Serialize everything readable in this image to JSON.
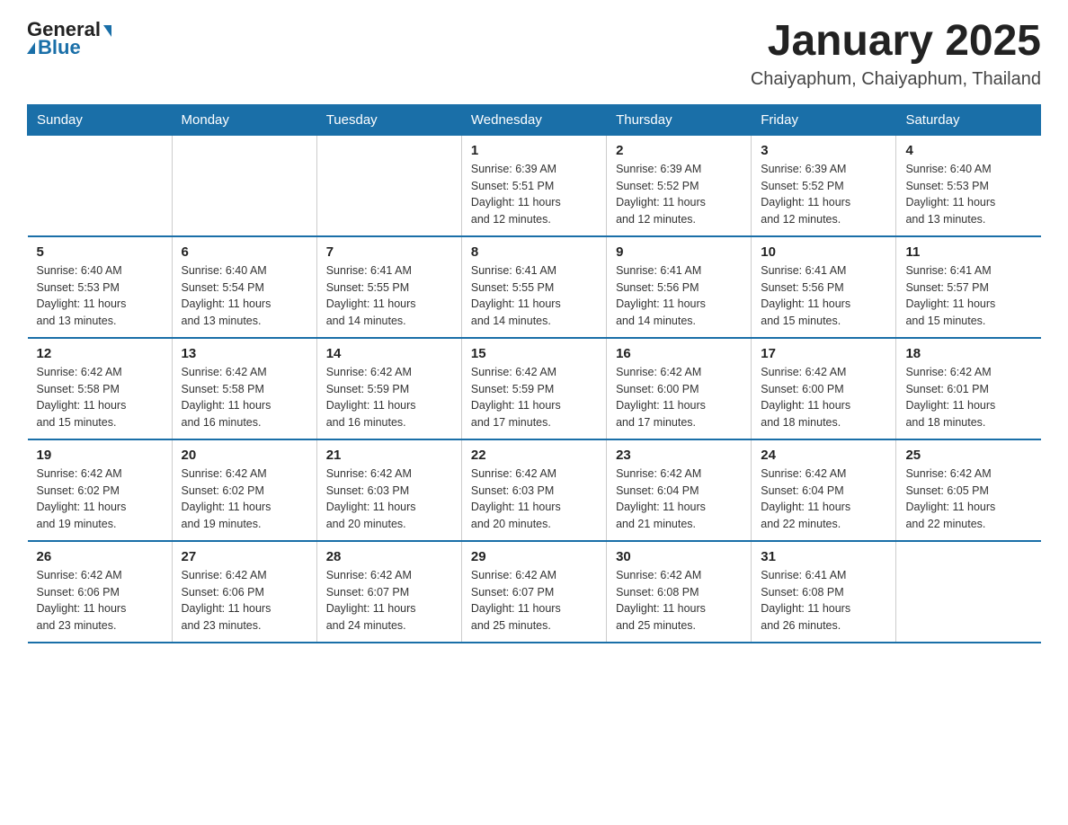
{
  "header": {
    "logo_general": "General",
    "logo_blue": "Blue",
    "month_title": "January 2025",
    "location": "Chaiyaphum, Chaiyaphum, Thailand"
  },
  "weekdays": [
    "Sunday",
    "Monday",
    "Tuesday",
    "Wednesday",
    "Thursday",
    "Friday",
    "Saturday"
  ],
  "weeks": [
    [
      {
        "day": "",
        "info": ""
      },
      {
        "day": "",
        "info": ""
      },
      {
        "day": "",
        "info": ""
      },
      {
        "day": "1",
        "info": "Sunrise: 6:39 AM\nSunset: 5:51 PM\nDaylight: 11 hours\nand 12 minutes."
      },
      {
        "day": "2",
        "info": "Sunrise: 6:39 AM\nSunset: 5:52 PM\nDaylight: 11 hours\nand 12 minutes."
      },
      {
        "day": "3",
        "info": "Sunrise: 6:39 AM\nSunset: 5:52 PM\nDaylight: 11 hours\nand 12 minutes."
      },
      {
        "day": "4",
        "info": "Sunrise: 6:40 AM\nSunset: 5:53 PM\nDaylight: 11 hours\nand 13 minutes."
      }
    ],
    [
      {
        "day": "5",
        "info": "Sunrise: 6:40 AM\nSunset: 5:53 PM\nDaylight: 11 hours\nand 13 minutes."
      },
      {
        "day": "6",
        "info": "Sunrise: 6:40 AM\nSunset: 5:54 PM\nDaylight: 11 hours\nand 13 minutes."
      },
      {
        "day": "7",
        "info": "Sunrise: 6:41 AM\nSunset: 5:55 PM\nDaylight: 11 hours\nand 14 minutes."
      },
      {
        "day": "8",
        "info": "Sunrise: 6:41 AM\nSunset: 5:55 PM\nDaylight: 11 hours\nand 14 minutes."
      },
      {
        "day": "9",
        "info": "Sunrise: 6:41 AM\nSunset: 5:56 PM\nDaylight: 11 hours\nand 14 minutes."
      },
      {
        "day": "10",
        "info": "Sunrise: 6:41 AM\nSunset: 5:56 PM\nDaylight: 11 hours\nand 15 minutes."
      },
      {
        "day": "11",
        "info": "Sunrise: 6:41 AM\nSunset: 5:57 PM\nDaylight: 11 hours\nand 15 minutes."
      }
    ],
    [
      {
        "day": "12",
        "info": "Sunrise: 6:42 AM\nSunset: 5:58 PM\nDaylight: 11 hours\nand 15 minutes."
      },
      {
        "day": "13",
        "info": "Sunrise: 6:42 AM\nSunset: 5:58 PM\nDaylight: 11 hours\nand 16 minutes."
      },
      {
        "day": "14",
        "info": "Sunrise: 6:42 AM\nSunset: 5:59 PM\nDaylight: 11 hours\nand 16 minutes."
      },
      {
        "day": "15",
        "info": "Sunrise: 6:42 AM\nSunset: 5:59 PM\nDaylight: 11 hours\nand 17 minutes."
      },
      {
        "day": "16",
        "info": "Sunrise: 6:42 AM\nSunset: 6:00 PM\nDaylight: 11 hours\nand 17 minutes."
      },
      {
        "day": "17",
        "info": "Sunrise: 6:42 AM\nSunset: 6:00 PM\nDaylight: 11 hours\nand 18 minutes."
      },
      {
        "day": "18",
        "info": "Sunrise: 6:42 AM\nSunset: 6:01 PM\nDaylight: 11 hours\nand 18 minutes."
      }
    ],
    [
      {
        "day": "19",
        "info": "Sunrise: 6:42 AM\nSunset: 6:02 PM\nDaylight: 11 hours\nand 19 minutes."
      },
      {
        "day": "20",
        "info": "Sunrise: 6:42 AM\nSunset: 6:02 PM\nDaylight: 11 hours\nand 19 minutes."
      },
      {
        "day": "21",
        "info": "Sunrise: 6:42 AM\nSunset: 6:03 PM\nDaylight: 11 hours\nand 20 minutes."
      },
      {
        "day": "22",
        "info": "Sunrise: 6:42 AM\nSunset: 6:03 PM\nDaylight: 11 hours\nand 20 minutes."
      },
      {
        "day": "23",
        "info": "Sunrise: 6:42 AM\nSunset: 6:04 PM\nDaylight: 11 hours\nand 21 minutes."
      },
      {
        "day": "24",
        "info": "Sunrise: 6:42 AM\nSunset: 6:04 PM\nDaylight: 11 hours\nand 22 minutes."
      },
      {
        "day": "25",
        "info": "Sunrise: 6:42 AM\nSunset: 6:05 PM\nDaylight: 11 hours\nand 22 minutes."
      }
    ],
    [
      {
        "day": "26",
        "info": "Sunrise: 6:42 AM\nSunset: 6:06 PM\nDaylight: 11 hours\nand 23 minutes."
      },
      {
        "day": "27",
        "info": "Sunrise: 6:42 AM\nSunset: 6:06 PM\nDaylight: 11 hours\nand 23 minutes."
      },
      {
        "day": "28",
        "info": "Sunrise: 6:42 AM\nSunset: 6:07 PM\nDaylight: 11 hours\nand 24 minutes."
      },
      {
        "day": "29",
        "info": "Sunrise: 6:42 AM\nSunset: 6:07 PM\nDaylight: 11 hours\nand 25 minutes."
      },
      {
        "day": "30",
        "info": "Sunrise: 6:42 AM\nSunset: 6:08 PM\nDaylight: 11 hours\nand 25 minutes."
      },
      {
        "day": "31",
        "info": "Sunrise: 6:41 AM\nSunset: 6:08 PM\nDaylight: 11 hours\nand 26 minutes."
      },
      {
        "day": "",
        "info": ""
      }
    ]
  ]
}
